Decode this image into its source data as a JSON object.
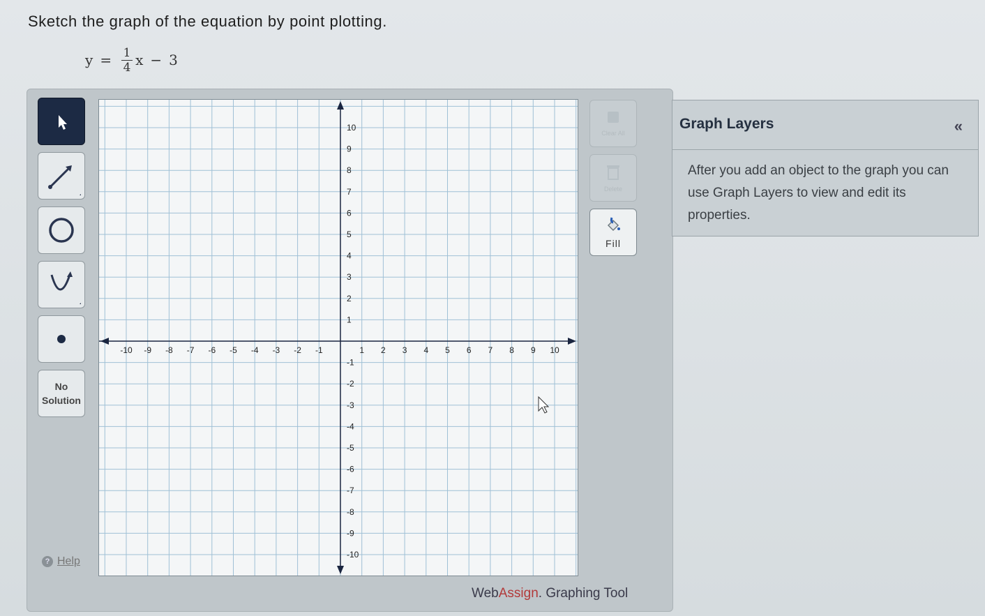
{
  "instruction": "Sketch the graph of the equation by point plotting.",
  "equation": {
    "lhs": "y",
    "eq": "=",
    "numerator": "1",
    "denominator": "4",
    "var": "x",
    "minus": "−",
    "constant": "3"
  },
  "toolbar": {
    "tools": [
      {
        "name": "pointer-tool",
        "icon": "arrow-pointer-icon",
        "active": true
      },
      {
        "name": "line-tool",
        "icon": "line-segment-icon"
      },
      {
        "name": "circle-tool",
        "icon": "circle-icon"
      },
      {
        "name": "parabola-tool",
        "icon": "parabola-icon"
      },
      {
        "name": "point-tool",
        "icon": "point-icon"
      }
    ],
    "no_solution_line1": "No",
    "no_solution_line2": "Solution",
    "help_label": "Help"
  },
  "graph": {
    "x_ticks": [
      "-10",
      "-9",
      "-8",
      "-7",
      "-6",
      "-5",
      "-4",
      "-3",
      "-2",
      "-1",
      "1",
      "2",
      "3",
      "4",
      "5",
      "6",
      "7",
      "8",
      "9",
      "10"
    ],
    "y_ticks": [
      "10",
      "9",
      "8",
      "7",
      "6",
      "5",
      "4",
      "3",
      "2",
      "1",
      "-1",
      "-2",
      "-3",
      "-4",
      "-5",
      "-6",
      "-7",
      "-8",
      "-9",
      "-10"
    ],
    "xlim": [
      -11,
      11
    ],
    "ylim": [
      -11,
      11
    ],
    "grid": true
  },
  "side_actions": {
    "clear_all_label": "Clear All",
    "delete_label": "Delete",
    "fill_label": "Fill"
  },
  "footer": {
    "brand_part1": "Web",
    "brand_part2": "Assign",
    "rest": ". Graphing Tool"
  },
  "layers": {
    "title": "Graph Layers",
    "collapse_icon": "«",
    "description": "After you add an object to the graph you can use Graph Layers to view and edit its properties."
  },
  "colors": {
    "active_tool": "#1c2a44",
    "grid_line": "#9fc0d6",
    "axis": "#1a2540",
    "brand_red": "#b23a3a"
  }
}
